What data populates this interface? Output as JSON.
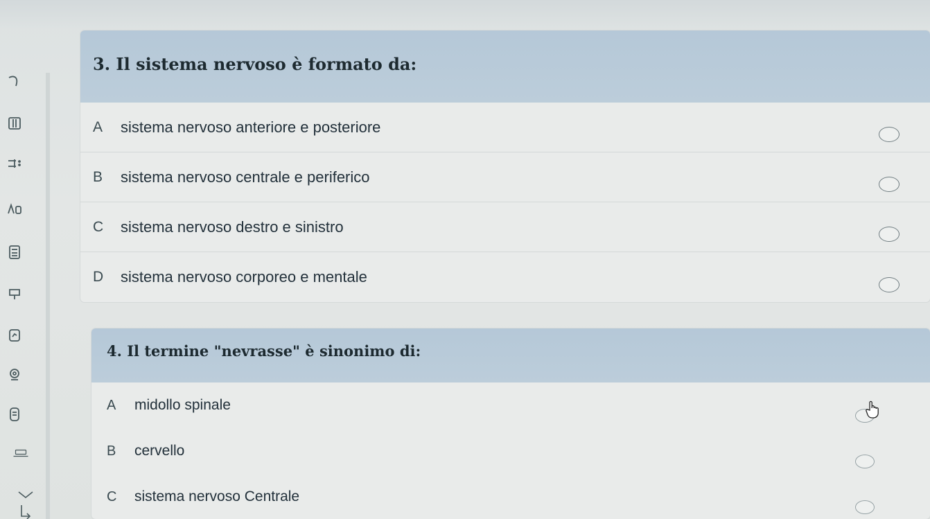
{
  "questions": [
    {
      "title": "3. Il sistema nervoso è formato da:",
      "options": [
        {
          "letter": "A",
          "text": "sistema nervoso anteriore e posteriore"
        },
        {
          "letter": "B",
          "text": "sistema nervoso centrale e periferico"
        },
        {
          "letter": "C",
          "text": "sistema nervoso destro e sinistro"
        },
        {
          "letter": "D",
          "text": "sistema nervoso corporeo e mentale"
        }
      ]
    },
    {
      "title": "4. Il termine \"nevrasse\" è sinonimo di:",
      "options": [
        {
          "letter": "A",
          "text": "midollo spinale"
        },
        {
          "letter": "B",
          "text": "cervello"
        },
        {
          "letter": "C",
          "text": "sistema nervoso Centrale"
        }
      ]
    }
  ],
  "toolbar": {
    "icons": [
      "undo-icon",
      "pause-icon",
      "list-icon",
      "text-icon",
      "calculator-icon",
      "highlighter-icon",
      "note-icon",
      "zoom-icon",
      "document-icon",
      "keyboard-icon",
      "chevron-down-icon",
      "exit-icon"
    ]
  },
  "colors": {
    "question_header": "#b5c8d8",
    "card_background": "#e9ebea",
    "page_background": "#e2e6e6"
  }
}
